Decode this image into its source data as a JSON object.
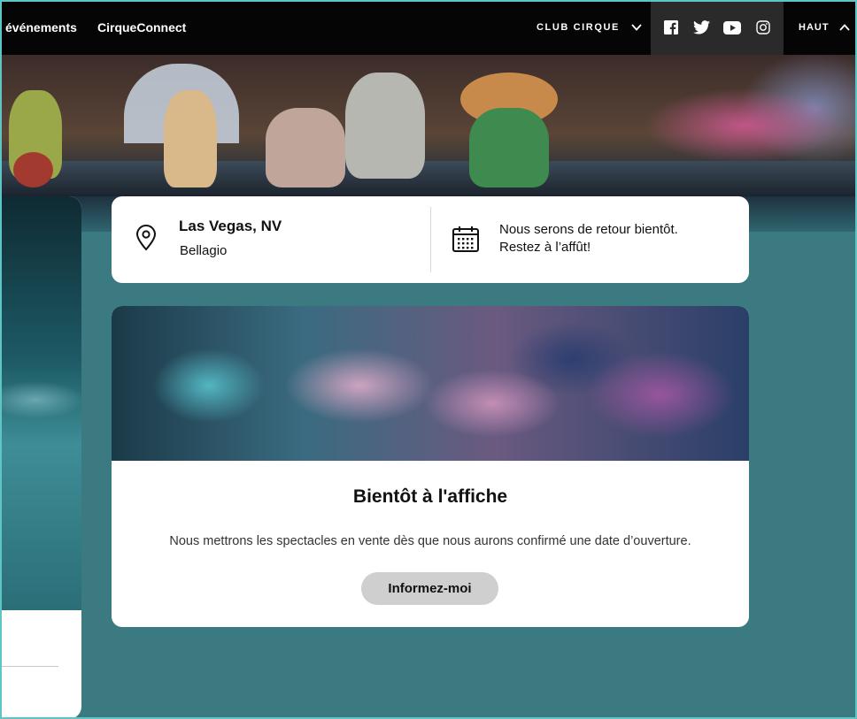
{
  "nav": {
    "events_label": "événements",
    "connect_label": "CirqueConnect",
    "club_label": "CLUB CIRQUE",
    "top_label": "HAUT"
  },
  "icons": {
    "club_chevron": "chevron-down-icon",
    "top_chevron": "chevron-up-icon",
    "social": [
      "facebook-icon",
      "twitter-icon",
      "youtube-icon",
      "instagram-icon"
    ]
  },
  "location": {
    "city": "Las Vegas, NV",
    "venue": "Bellagio"
  },
  "schedule": {
    "line1": "Nous serons de retour bientôt.",
    "line2": "Restez à l’affût!"
  },
  "show": {
    "title": "Bientôt à l'affiche",
    "description": "Nous mettrons les spectacles en vente dès que nous aurons confirmé une date d’ouverture.",
    "button_label": "Informez-moi"
  },
  "colors": {
    "nav_bg": "#050505",
    "social_bg": "#2a2a2a",
    "page_bg": "#3b7a80",
    "button_bg": "#cfcfcf"
  }
}
